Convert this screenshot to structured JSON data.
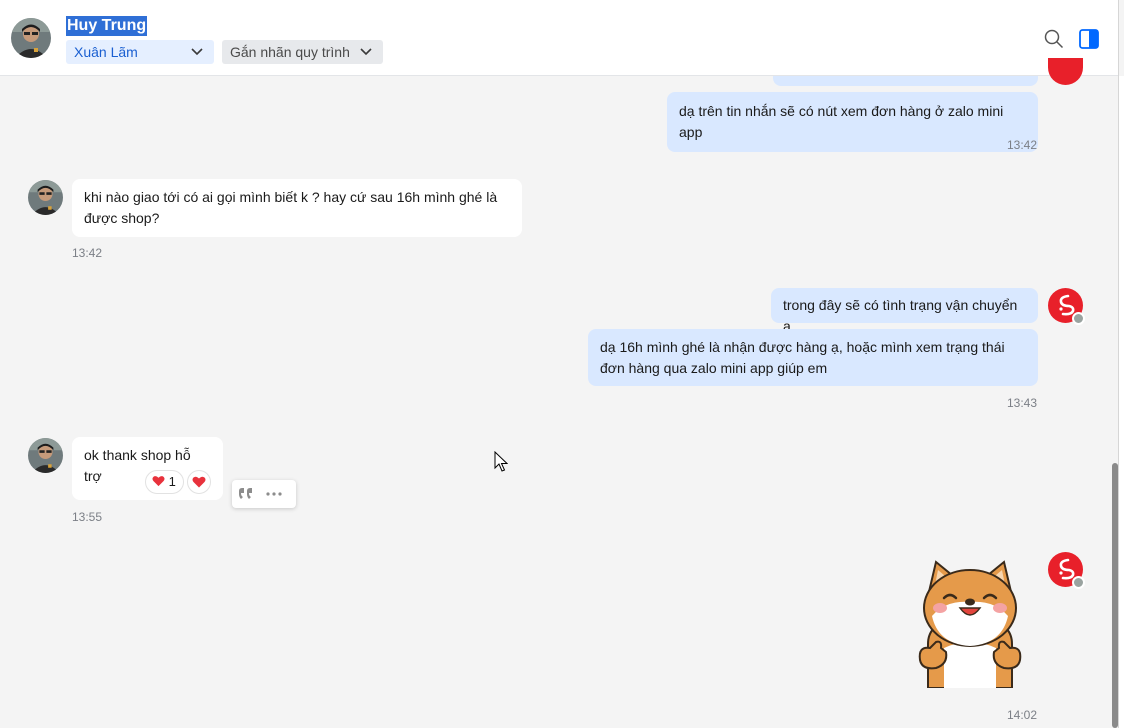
{
  "header": {
    "contact_name": "Huy Trung",
    "customer_tag": "Xuân Lãm",
    "workflow_label": "Gắn nhãn quy trình",
    "icons": [
      "search-icon",
      "side-panel-icon"
    ],
    "accent_color": "#0068ff"
  },
  "messages": [
    {
      "direction": "outgoing",
      "text": "dạ trên tin nhắn sẽ có nút xem đơn hàng ở zalo mini app",
      "time": "13:42"
    },
    {
      "direction": "incoming",
      "text": "khi nào giao tới có ai gọi mình biết k ? hay cứ sau 16h mình ghé là được shop?",
      "time": "13:42"
    },
    {
      "direction": "outgoing",
      "text": "trong đây sẽ có tình trạng vận chuyển ạ"
    },
    {
      "direction": "outgoing",
      "text": "dạ 16h mình ghé là nhận được hàng ạ, hoặc mình xem trạng thái đơn hàng qua zalo mini app giúp em",
      "time": "13:43"
    },
    {
      "direction": "incoming",
      "text": "ok thank shop hỗ trợ",
      "time": "13:55",
      "reaction": {
        "emoji": "heart",
        "count": "1"
      }
    },
    {
      "direction": "outgoing",
      "type": "sticker",
      "sticker": "shiba-dog-thumbs-up",
      "time": "14:02"
    }
  ],
  "colors": {
    "outgoing_bubble": "#d9e8ff",
    "incoming_bubble": "#ffffff",
    "shop_avatar": "#e8202a",
    "chat_background": "#f4f4f4"
  }
}
